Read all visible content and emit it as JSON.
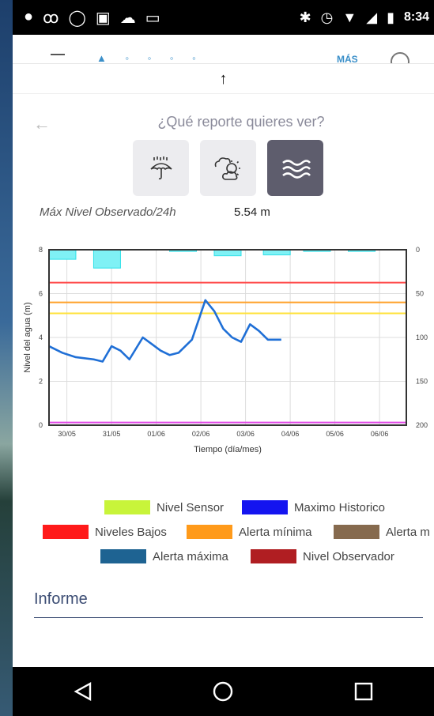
{
  "status_bar": {
    "time": "8:34",
    "left_icons": [
      "spotify-icon",
      "voicemail-icon",
      "whatsapp-icon",
      "image-icon",
      "cloud-icon",
      "laptop-icon"
    ],
    "right_icons": [
      "bluetooth-icon",
      "alarm-icon",
      "wifi-icon",
      "signal-icon",
      "battery-icon"
    ]
  },
  "nav": {
    "more_label": "MÁS"
  },
  "report": {
    "question": "¿Qué reporte quieres ver?",
    "options": [
      {
        "name": "rain",
        "active": false
      },
      {
        "name": "weather",
        "active": false
      },
      {
        "name": "water-level",
        "active": true
      }
    ],
    "max_label": "Máx Nivel Observado/24h",
    "max_value": "5.54 m"
  },
  "chart_data": {
    "type": "line",
    "xlabel": "Tiempo (día/mes)",
    "ylabel": "Nivel del agua (m)",
    "x_ticks": [
      "30/05",
      "31/05",
      "01/06",
      "02/06",
      "03/06",
      "04/06",
      "05/06",
      "06/06"
    ],
    "ylim": [
      0,
      8
    ],
    "y_ticks": [
      0,
      2,
      4,
      6,
      8
    ],
    "y2lim": [
      0,
      200
    ],
    "y2_ticks": [
      0,
      50,
      100,
      150,
      200
    ],
    "grid": true,
    "series": [
      {
        "color": "#1f6fd6",
        "x": [
          0,
          0.3,
          0.6,
          1.0,
          1.2,
          1.4,
          1.6,
          1.8,
          2.1,
          2.3,
          2.5,
          2.7,
          2.9,
          3.2,
          3.5,
          3.7,
          3.9,
          4.1,
          4.3,
          4.5,
          4.7,
          4.9,
          5.2
        ],
        "y": [
          3.6,
          3.3,
          3.1,
          3.0,
          2.9,
          3.6,
          3.4,
          3.0,
          4.0,
          3.7,
          3.4,
          3.2,
          3.3,
          3.9,
          5.7,
          5.2,
          4.4,
          4.0,
          3.8,
          4.6,
          4.3,
          3.9,
          3.9
        ]
      },
      {
        "color": "#2fe0e8",
        "type": "bars",
        "x": [
          0.3,
          1.3,
          3.0,
          4.0,
          5.1,
          6.0,
          7.0
        ],
        "mm": [
          10,
          20,
          1,
          6,
          5,
          1,
          1
        ]
      }
    ],
    "hlines": [
      {
        "y": 6.5,
        "color": "#ff4a4a"
      },
      {
        "y": 5.6,
        "color": "#ffa12a"
      },
      {
        "y": 5.1,
        "color": "#ffe23a"
      },
      {
        "y": 0.12,
        "color": "#e24ae8"
      }
    ]
  },
  "legend": [
    {
      "label": "Nivel Sensor",
      "color": "#c8f43a"
    },
    {
      "label": "Maximo Historico",
      "color": "#1414f0"
    },
    {
      "label": "Niveles Bajos",
      "color": "#ff1a1a"
    },
    {
      "label": "Alerta mínima",
      "color": "#ff9a1a"
    },
    {
      "label": "Alerta m",
      "color": "#866a4e"
    },
    {
      "label": "Alerta máxima",
      "color": "#1e6392"
    },
    {
      "label": "Nivel Observador",
      "color": "#b01e22"
    }
  ],
  "informe": {
    "label": "Informe"
  }
}
